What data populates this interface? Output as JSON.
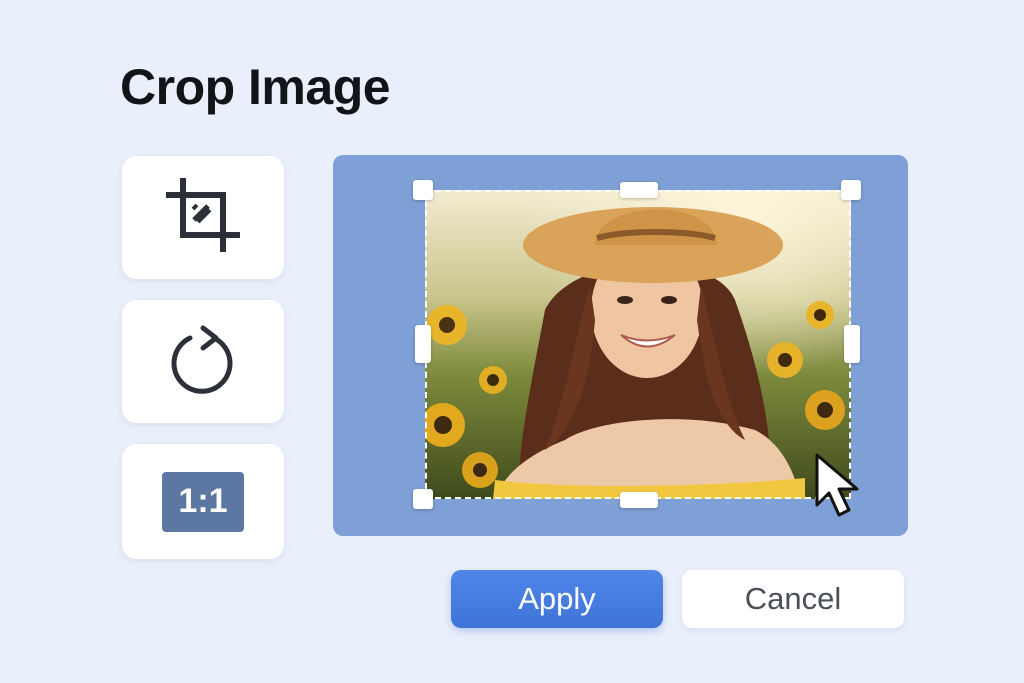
{
  "header": {
    "title": "Crop Image"
  },
  "tools": [
    {
      "name": "crop",
      "icon": "crop-icon"
    },
    {
      "name": "rotate",
      "icon": "rotate-icon"
    },
    {
      "name": "aspect-ratio",
      "label": "1:1"
    }
  ],
  "editor": {
    "image": "portrait-photo"
  },
  "actions": {
    "apply_label": "Apply",
    "cancel_label": "Cancel"
  },
  "colors": {
    "accent": "#3f73d8",
    "panel": "#7ea0d6",
    "ratio_badge": "#5c77a1",
    "background": "#eaf0fb"
  }
}
